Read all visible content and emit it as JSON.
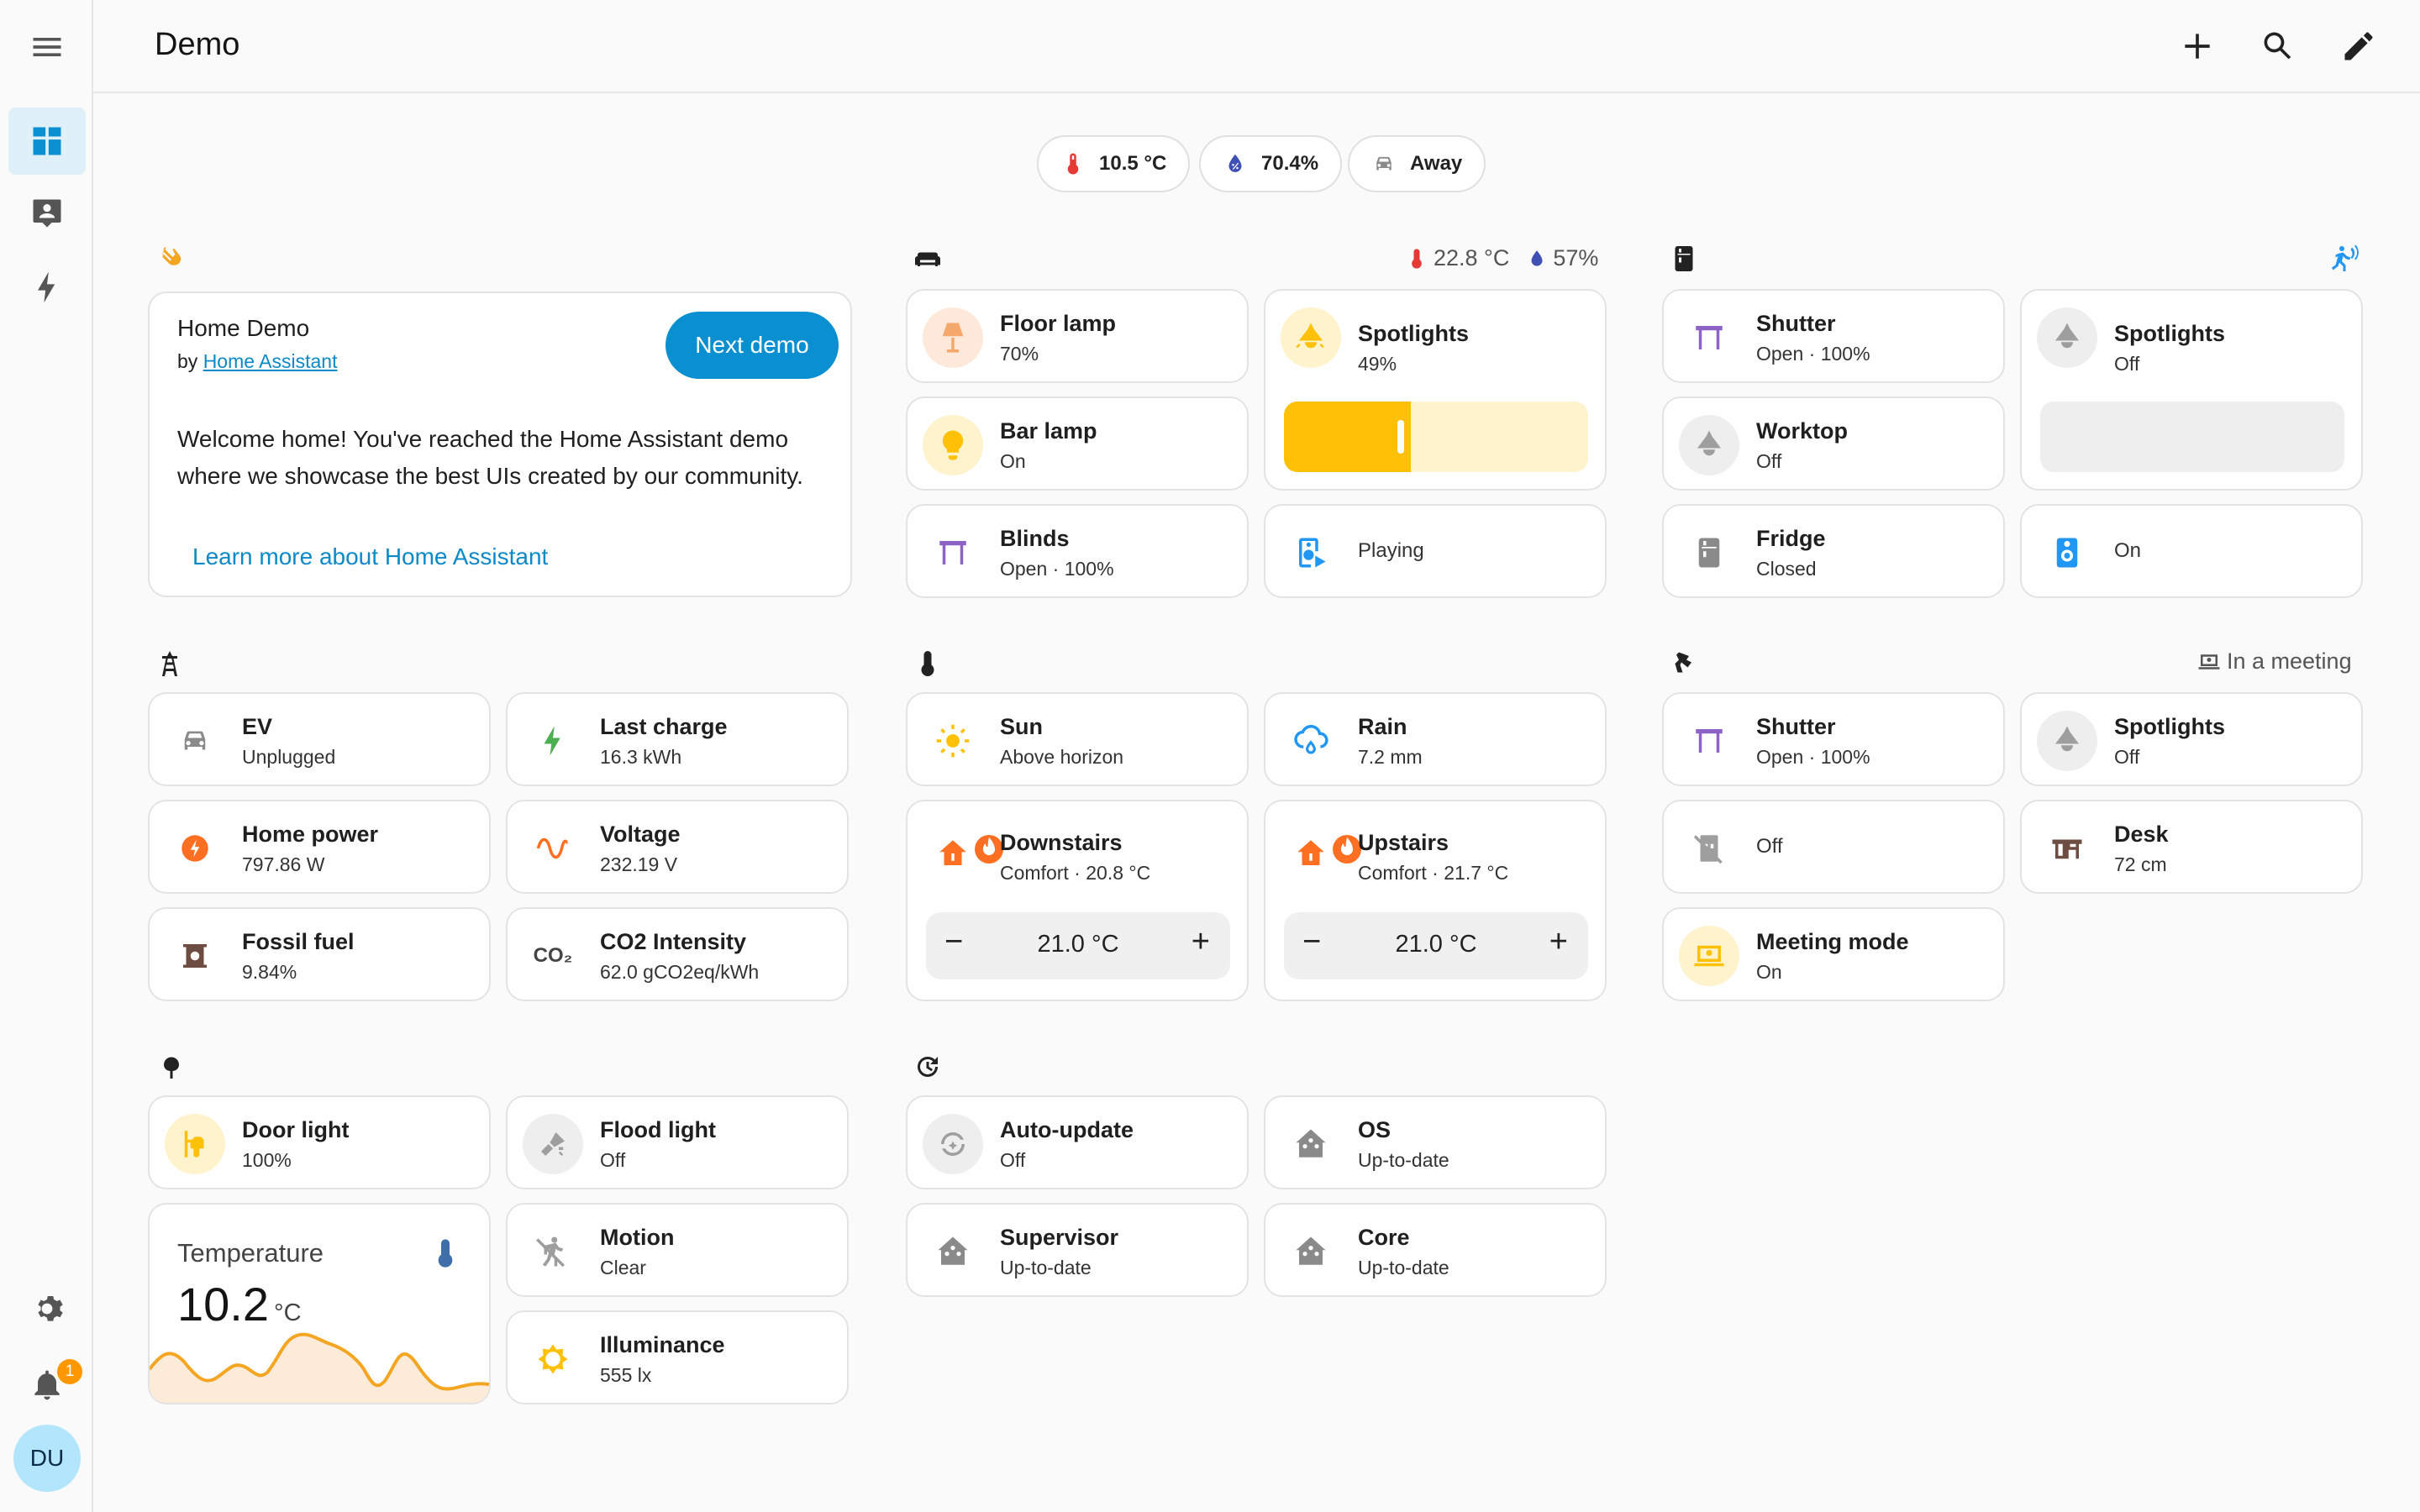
{
  "header": {
    "title": "Demo"
  },
  "sidebar": {
    "notification_count": "1",
    "user_initials": "DU"
  },
  "badges": [
    {
      "label": "10.5 °C",
      "icon": "thermometer-icon"
    },
    {
      "label": "70.4%",
      "icon": "water-percent-icon"
    },
    {
      "label": "Away",
      "icon": "car-icon"
    }
  ],
  "markdown": {
    "title": "Home Demo",
    "by_prefix": "by ",
    "by_link": "Home Assistant",
    "next_button": "Next demo",
    "body": "Welcome home! You've reached the Home Assistant demo where we showcase the best UIs created by our community.",
    "learn_more": "Learn more about Home Assistant"
  },
  "living": {
    "temp": "22.8 °C",
    "humidity": "57%",
    "floor_lamp": {
      "name": "Floor lamp",
      "state": "70%"
    },
    "spotlights": {
      "name": "Spotlights",
      "state": "49%",
      "brightness": 0.49
    },
    "bar_lamp": {
      "name": "Bar lamp",
      "state": "On"
    },
    "blinds": {
      "name": "Blinds",
      "state": "Open · 100%"
    },
    "media": {
      "state": "Playing"
    }
  },
  "kitchen": {
    "shutter": {
      "name": "Shutter",
      "state": "Open · 100%"
    },
    "spotlights": {
      "name": "Spotlights",
      "state": "Off",
      "brightness": 0
    },
    "worktop": {
      "name": "Worktop",
      "state": "Off"
    },
    "fridge": {
      "name": "Fridge",
      "state": "Closed"
    },
    "speaker": {
      "state": "On"
    }
  },
  "energy": {
    "ev": {
      "name": "EV",
      "state": "Unplugged"
    },
    "last_charge": {
      "name": "Last charge",
      "state": "16.3 kWh"
    },
    "home_power": {
      "name": "Home power",
      "state": "797.86 W"
    },
    "voltage": {
      "name": "Voltage",
      "state": "232.19 V"
    },
    "fossil": {
      "name": "Fossil fuel",
      "state": "9.84%"
    },
    "co2": {
      "name": "CO2 Intensity",
      "state": "62.0 gCO2eq/kWh",
      "icon_text": "CO₂"
    }
  },
  "climate": {
    "sun": {
      "name": "Sun",
      "state": "Above horizon"
    },
    "rain": {
      "name": "Rain",
      "state": "7.2 mm"
    },
    "downstairs": {
      "name": "Downstairs",
      "state": "Comfort · 20.8 °C",
      "target": "21.0 °C"
    },
    "upstairs": {
      "name": "Upstairs",
      "state": "Comfort · 21.7 °C",
      "target": "21.0 °C"
    }
  },
  "office": {
    "status": "In a meeting",
    "shutter": {
      "name": "Shutter",
      "state": "Open · 100%"
    },
    "spotlights": {
      "name": "Spotlights",
      "state": "Off"
    },
    "plug": {
      "state": "Off"
    },
    "desk": {
      "name": "Desk",
      "state": "72 cm"
    },
    "meeting": {
      "name": "Meeting mode",
      "state": "On"
    }
  },
  "garden": {
    "door_light": {
      "name": "Door light",
      "state": "100%"
    },
    "flood_light": {
      "name": "Flood light",
      "state": "Off"
    },
    "temperature": {
      "name": "Temperature",
      "value": "10.2",
      "unit": "°C"
    },
    "motion": {
      "name": "Motion",
      "state": "Clear"
    },
    "illuminance": {
      "name": "Illuminance",
      "state": "555 lx"
    }
  },
  "updates": {
    "auto": {
      "name": "Auto-update",
      "state": "Off"
    },
    "os": {
      "name": "OS",
      "state": "Up-to-date"
    },
    "supervisor": {
      "name": "Supervisor",
      "state": "Up-to-date"
    },
    "core": {
      "name": "Core",
      "state": "Up-to-date"
    }
  },
  "colors": {
    "accent": "#0a8fd0",
    "light_on": "#ffc107",
    "cover": "#8e63c7",
    "energy": "#ff6f22",
    "inactive": "#9e9e9e"
  }
}
